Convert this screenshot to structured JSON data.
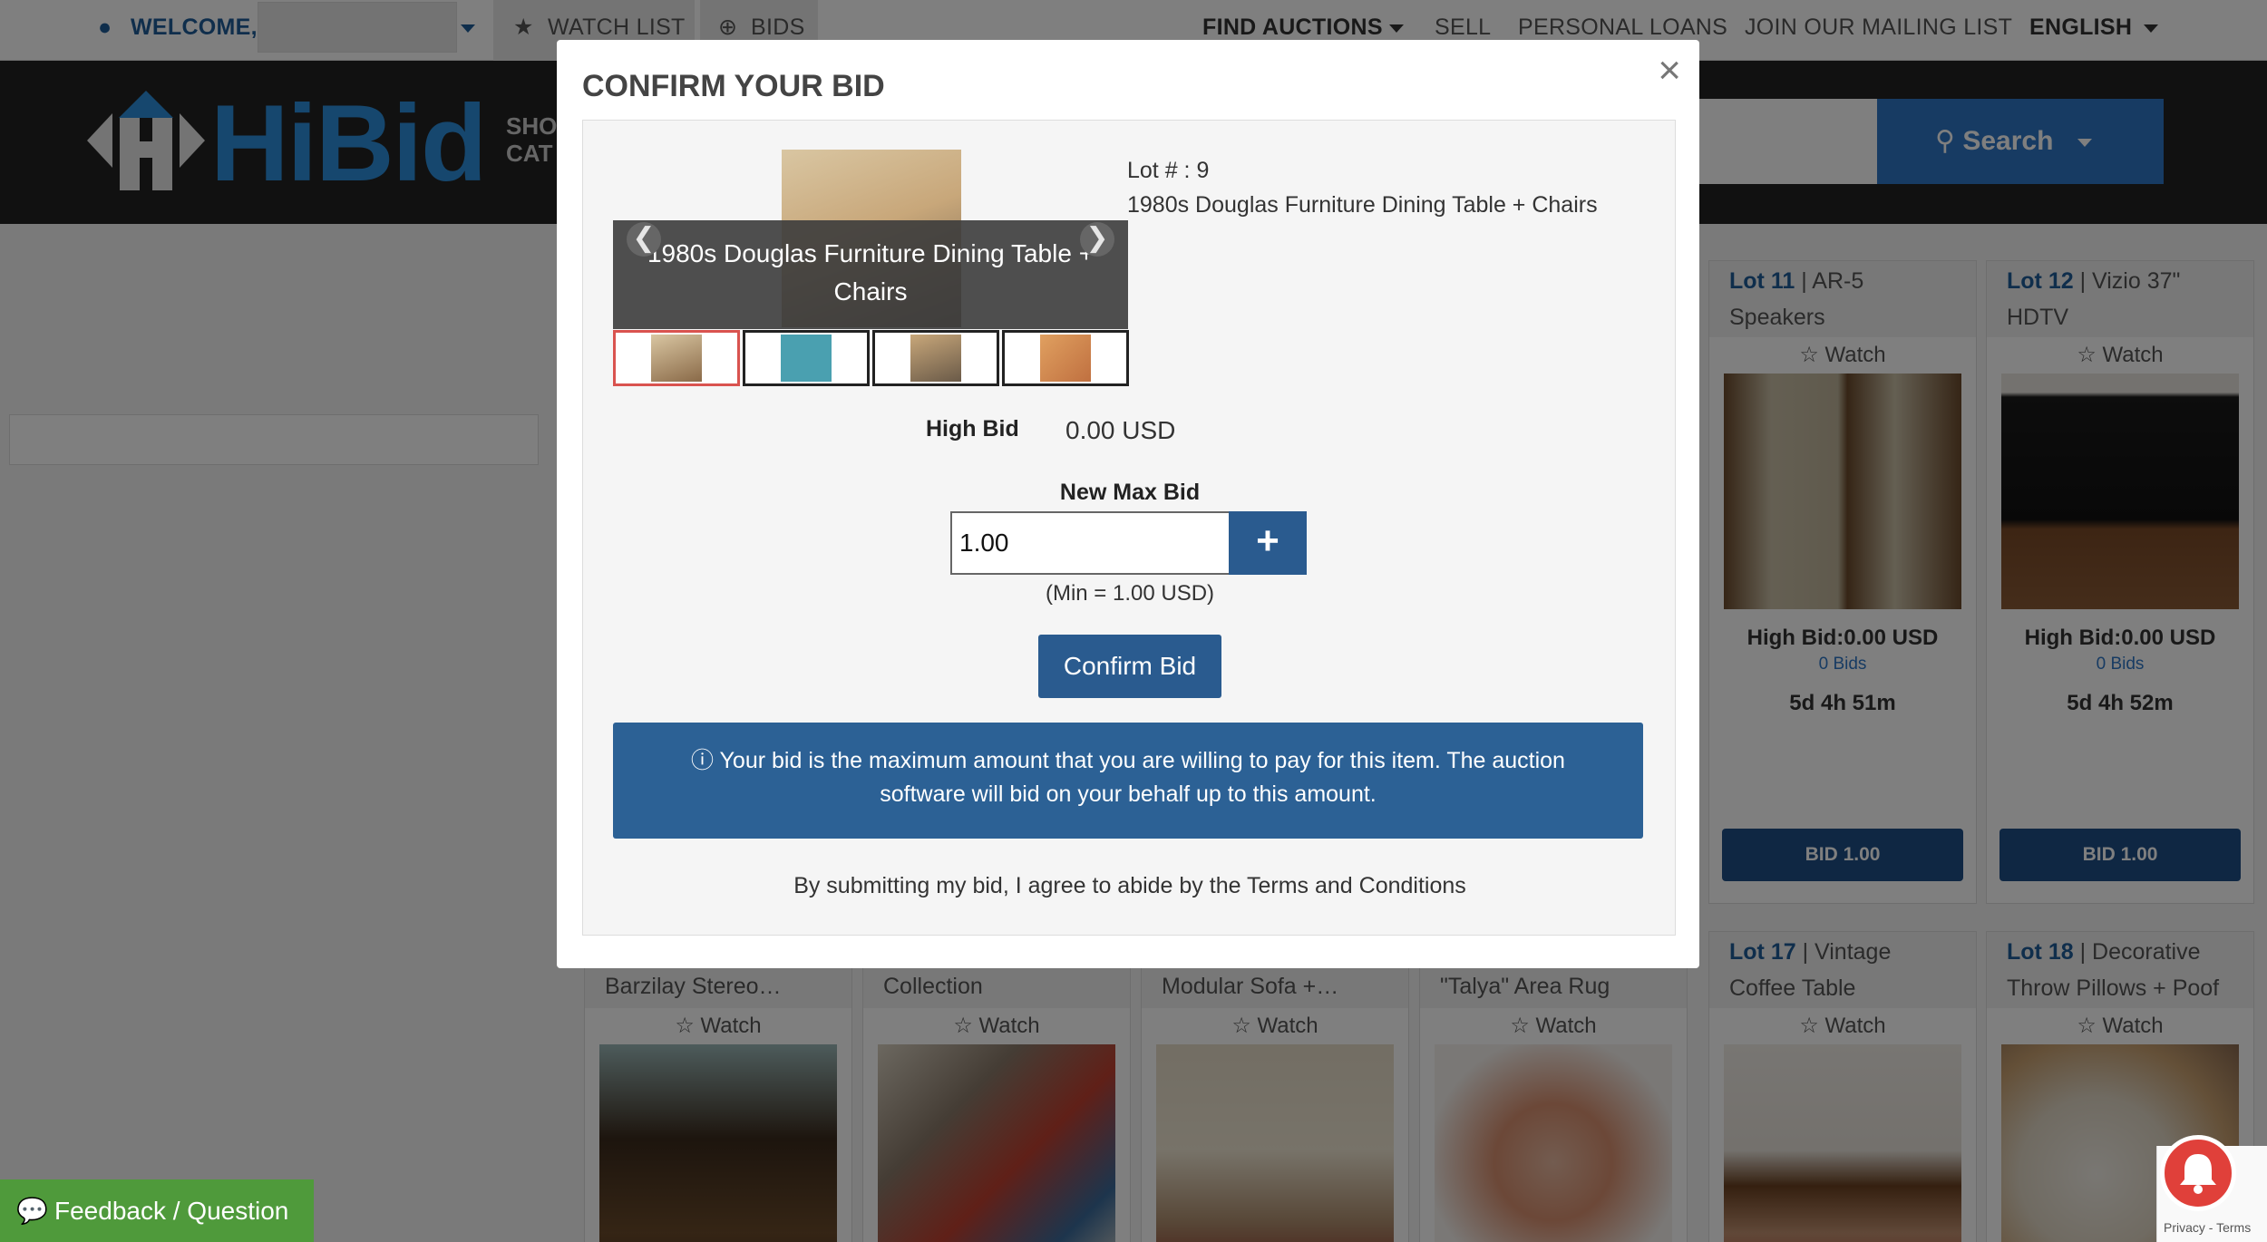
{
  "topnav": {
    "welcome": "WELCOME,",
    "watch_list": "WATCH LIST",
    "bids": "BIDS",
    "find_auctions": "FIND AUCTIONS",
    "sell": "SELL",
    "personal_loans": "PERSONAL LOANS",
    "mailing_list": "JOIN OUR MAILING LIST",
    "language": "ENGLISH"
  },
  "header": {
    "logo": "HiBid",
    "shop_categories": "SHO\nCAT",
    "search_label": "Search"
  },
  "modal": {
    "title": "CONFIRM YOUR BID",
    "close": "×",
    "caption": "1980s Douglas Furniture Dining Table + Chairs",
    "lot_number": "Lot # : 9",
    "lot_title": "1980s Douglas Furniture Dining Table + Chairs",
    "high_bid_label": "High Bid",
    "high_bid_value": "0.00 USD",
    "new_max_bid_label": "New Max Bid",
    "bid_value": "1.00",
    "plus": "+",
    "min_note": "(Min = 1.00 USD)",
    "confirm_label": "Confirm Bid",
    "info_text": "Your bid is the maximum amount that you are willing to pay for this item. The auction software will bid on your behalf up to this amount.",
    "terms_text": "By submitting my bid, I agree to abide by the Terms and Conditions",
    "thumbnails": 4
  },
  "cards_row1": [
    {
      "lot": "Lot 11",
      "name": "AR-5 Speakers",
      "watch": "Watch",
      "high_bid": "High Bid:0.00 USD",
      "bids": "0 Bids",
      "time_left": "5d 4h 51m",
      "bid_button": "BID 1.00"
    },
    {
      "lot": "Lot 12",
      "name": "Vizio 37\" HDTV",
      "watch": "Watch",
      "high_bid": "High Bid:0.00 USD",
      "bids": "0 Bids",
      "time_left": "5d 4h 52m",
      "bid_button": "BID 1.00"
    }
  ],
  "cards_row2": [
    {
      "lot": "",
      "name": "Barzilay Stereo…",
      "watch": "Watch"
    },
    {
      "lot": "",
      "name": "Collection",
      "watch": "Watch"
    },
    {
      "lot": "",
      "name": "Modular Sofa +…",
      "watch": "Watch"
    },
    {
      "lot": "",
      "name": "\"Talya\" Area Rug",
      "watch": "Watch"
    },
    {
      "lot": "Lot 17",
      "name": "Vintage Coffee Table",
      "watch": "Watch"
    },
    {
      "lot": "Lot 18",
      "name": "Decorative Throw Pillows + Poof",
      "watch": "Watch"
    }
  ],
  "footer": {
    "feedback": "Feedback / Question",
    "recaptcha": "Privacy - Terms"
  },
  "colors": {
    "brand_blue": "#2a5b8f",
    "logo_blue": "#2d8fdc",
    "feedback_green": "#4f9a3b",
    "alert_red": "#e0403a"
  }
}
